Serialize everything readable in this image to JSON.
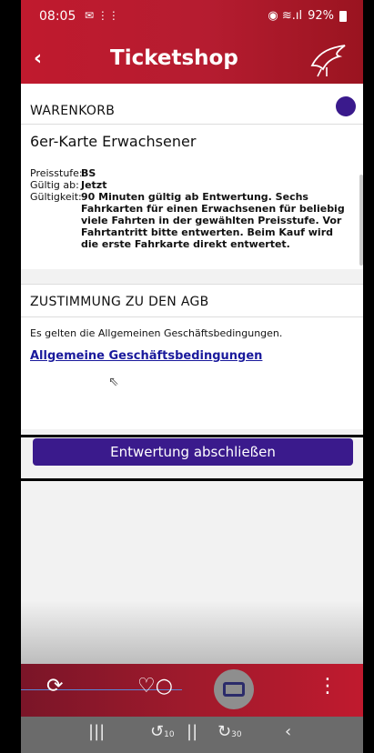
{
  "status": {
    "time": "08:05",
    "time_icons": "✉ ⋮⋮",
    "signal": "◉ ≋.ıl",
    "battery": "92%"
  },
  "appbar": {
    "back_icon": "‹",
    "title": "Ticketshop"
  },
  "cart": {
    "header": "WARENKORB",
    "product": "6er-Karte Erwachsener",
    "details": [
      {
        "key": "Preisstufe:",
        "value": "BS"
      },
      {
        "key": "Gültig ab:",
        "value": "Jetzt"
      },
      {
        "key": "Gültigkeit:",
        "value": "90 Minuten gültig ab Entwertung. Sechs Fahrkarten für einen Erwachsenen für beliebig viele Fahrten in der gewählten Preisstufe. Vor Fahrtantritt bitte entwerten. Beim Kauf wird die erste Fahrkarte direkt entwertet."
      }
    ]
  },
  "agb": {
    "header": "ZUSTIMMUNG ZU DEN AGB",
    "text": "Es gelten die Allgemeinen Geschäftsbedingungen.",
    "link": "Allgemeine Geschäftsbedingungen"
  },
  "action": {
    "button": "Entwertung abschließen"
  },
  "bottomnav": {
    "item1": "⟳",
    "item2": "♡○",
    "item3_icon": "ticket-icon",
    "item4": "⋮"
  },
  "sysnav": {
    "recent": "|||",
    "rewind": "↺",
    "rewind_label": "10",
    "pause": "||",
    "forward": "↻",
    "forward_label": "30",
    "back": "‹"
  },
  "colors": {
    "brand_red": "#c01a2e",
    "accent_purple": "#3a1a8c",
    "link_blue": "#1a1a9c"
  }
}
